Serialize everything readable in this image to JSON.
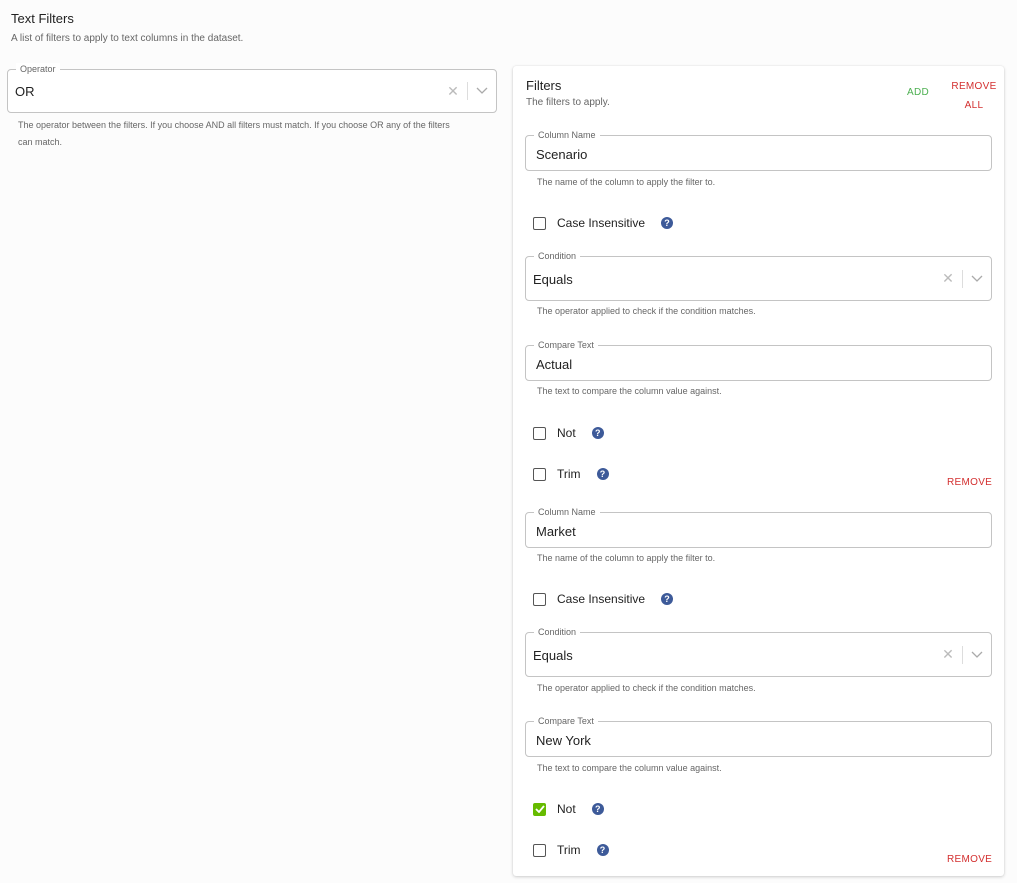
{
  "header": {
    "title": "Text Filters",
    "description": "A list of filters to apply to text columns in the dataset."
  },
  "operator": {
    "label": "Operator",
    "value": "OR",
    "helper_line1": "The operator between the filters. If you choose AND all filters must match. If you choose OR any of the filters",
    "helper_line2": "can match."
  },
  "filters_panel": {
    "title": "Filters",
    "description": "The filters to apply.",
    "add_label": "ADD",
    "remove_all_label": "REMOVE ALL"
  },
  "filters": [
    {
      "column_label": "Column Name",
      "column_value": "Scenario",
      "column_helper": "The name of the column to apply the filter to.",
      "case_insensitive_label": "Case Insensitive",
      "case_insensitive": false,
      "condition_label": "Condition",
      "condition_value": "Equals",
      "condition_helper": "The operator applied to check if the condition matches.",
      "compare_label": "Compare Text",
      "compare_value": "Actual",
      "compare_helper": "The text to compare the column value against.",
      "not_label": "Not",
      "not": false,
      "trim_label": "Trim",
      "trim": false,
      "remove_label": "REMOVE"
    },
    {
      "column_label": "Column Name",
      "column_value": "Market",
      "column_helper": "The name of the column to apply the filter to.",
      "case_insensitive_label": "Case Insensitive",
      "case_insensitive": false,
      "condition_label": "Condition",
      "condition_value": "Equals",
      "condition_helper": "The operator applied to check if the condition matches.",
      "compare_label": "Compare Text",
      "compare_value": "New York",
      "compare_helper": "The text to compare the column value against.",
      "not_label": "Not",
      "not": true,
      "trim_label": "Trim",
      "trim": false,
      "remove_label": "REMOVE"
    }
  ],
  "icons": {
    "help": "question-circle-icon",
    "clear": "close-icon",
    "dropdown": "chevron-down-icon",
    "check": "checkmark-icon"
  },
  "colors": {
    "add": "#4caf50",
    "remove": "#d32f2f",
    "checked": "#66bb00",
    "help_icon": "#3d5a99"
  }
}
